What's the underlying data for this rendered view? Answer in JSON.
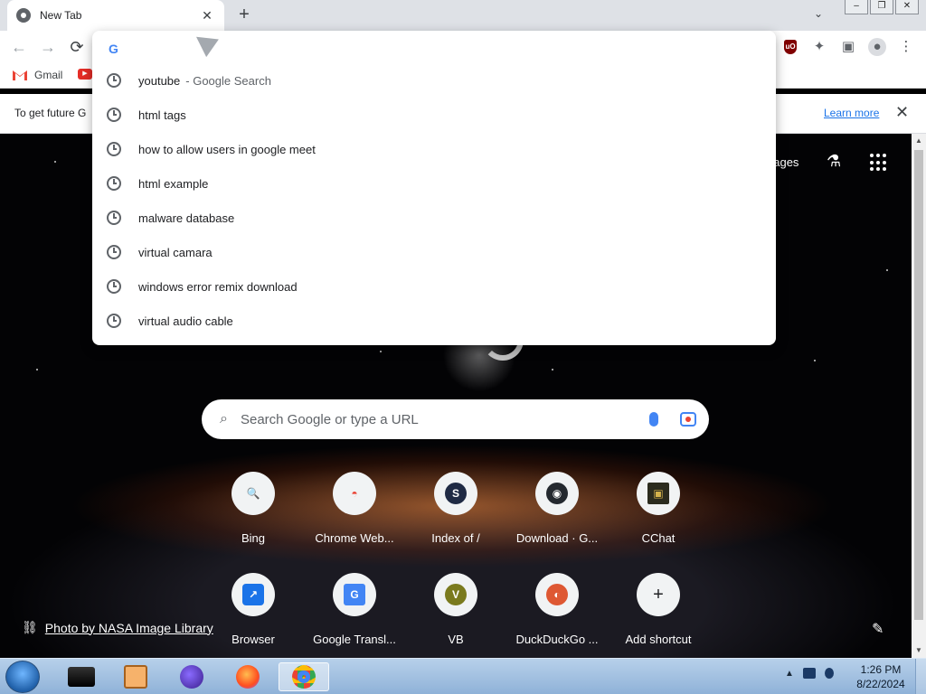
{
  "browser": {
    "tab_title": "New Tab",
    "tab_close": "✕",
    "new_tab": "+",
    "tab_search": "⌄",
    "win_min": "–",
    "win_max": "❐",
    "win_close": "✕"
  },
  "toolbar": {
    "back": "←",
    "forward": "→",
    "reload": "⟳",
    "ublock": "uO",
    "extensions": "✦",
    "sidepanel": "▣",
    "profile": "●",
    "menu": "⋮"
  },
  "bookmarks": [
    {
      "label": "Gmail",
      "icon": "gmail-icon"
    },
    {
      "label": "",
      "icon": "youtube-icon"
    }
  ],
  "infobar": {
    "text": "To get future G",
    "learn_more": "Learn more",
    "close": "✕"
  },
  "omnibox": {
    "logo": "G",
    "suggestions": [
      {
        "text": "youtube",
        "desc": "- Google Search"
      },
      {
        "text": "html tags",
        "desc": ""
      },
      {
        "text": "how to allow users in google meet",
        "desc": ""
      },
      {
        "text": "html example",
        "desc": ""
      },
      {
        "text": "malware database",
        "desc": ""
      },
      {
        "text": "virtual camara",
        "desc": ""
      },
      {
        "text": "windows error remix download",
        "desc": ""
      },
      {
        "text": "virtual audio cable",
        "desc": ""
      }
    ]
  },
  "ntp": {
    "images_link": "nages",
    "search_placeholder": "Search Google or type a URL",
    "search_icon": "⌕",
    "shortcuts": [
      {
        "label": "Bing",
        "glyph": "🔍",
        "color": "#e8f0fe"
      },
      {
        "label": "Chrome Web...",
        "glyph": "◓",
        "color": "#ea4335"
      },
      {
        "label": "Index of /",
        "glyph": "S",
        "color": "#1f2a44"
      },
      {
        "label": "Download · G...",
        "glyph": "◉",
        "color": "#24292f"
      },
      {
        "label": "CChat",
        "glyph": "▣",
        "color": "#2b2b1e"
      },
      {
        "label": "Browser",
        "glyph": "↗",
        "color": "#1a73e8"
      },
      {
        "label": "Google Transl...",
        "glyph": "G",
        "color": "#4285f4"
      },
      {
        "label": "VB",
        "glyph": "V",
        "color": "#7a7a1e"
      },
      {
        "label": "DuckDuckGo ...",
        "glyph": "◐",
        "color": "#de5833"
      },
      {
        "label": "Add shortcut",
        "glyph": "+",
        "color": "#f1f3f4"
      }
    ],
    "photo_credit": "Photo by NASA Image Library",
    "link_icon": "⛓",
    "customize_icon": "✎"
  },
  "taskbar": {
    "time": "1:26 PM",
    "date": "8/22/2024",
    "tray_arrow": "▲"
  }
}
